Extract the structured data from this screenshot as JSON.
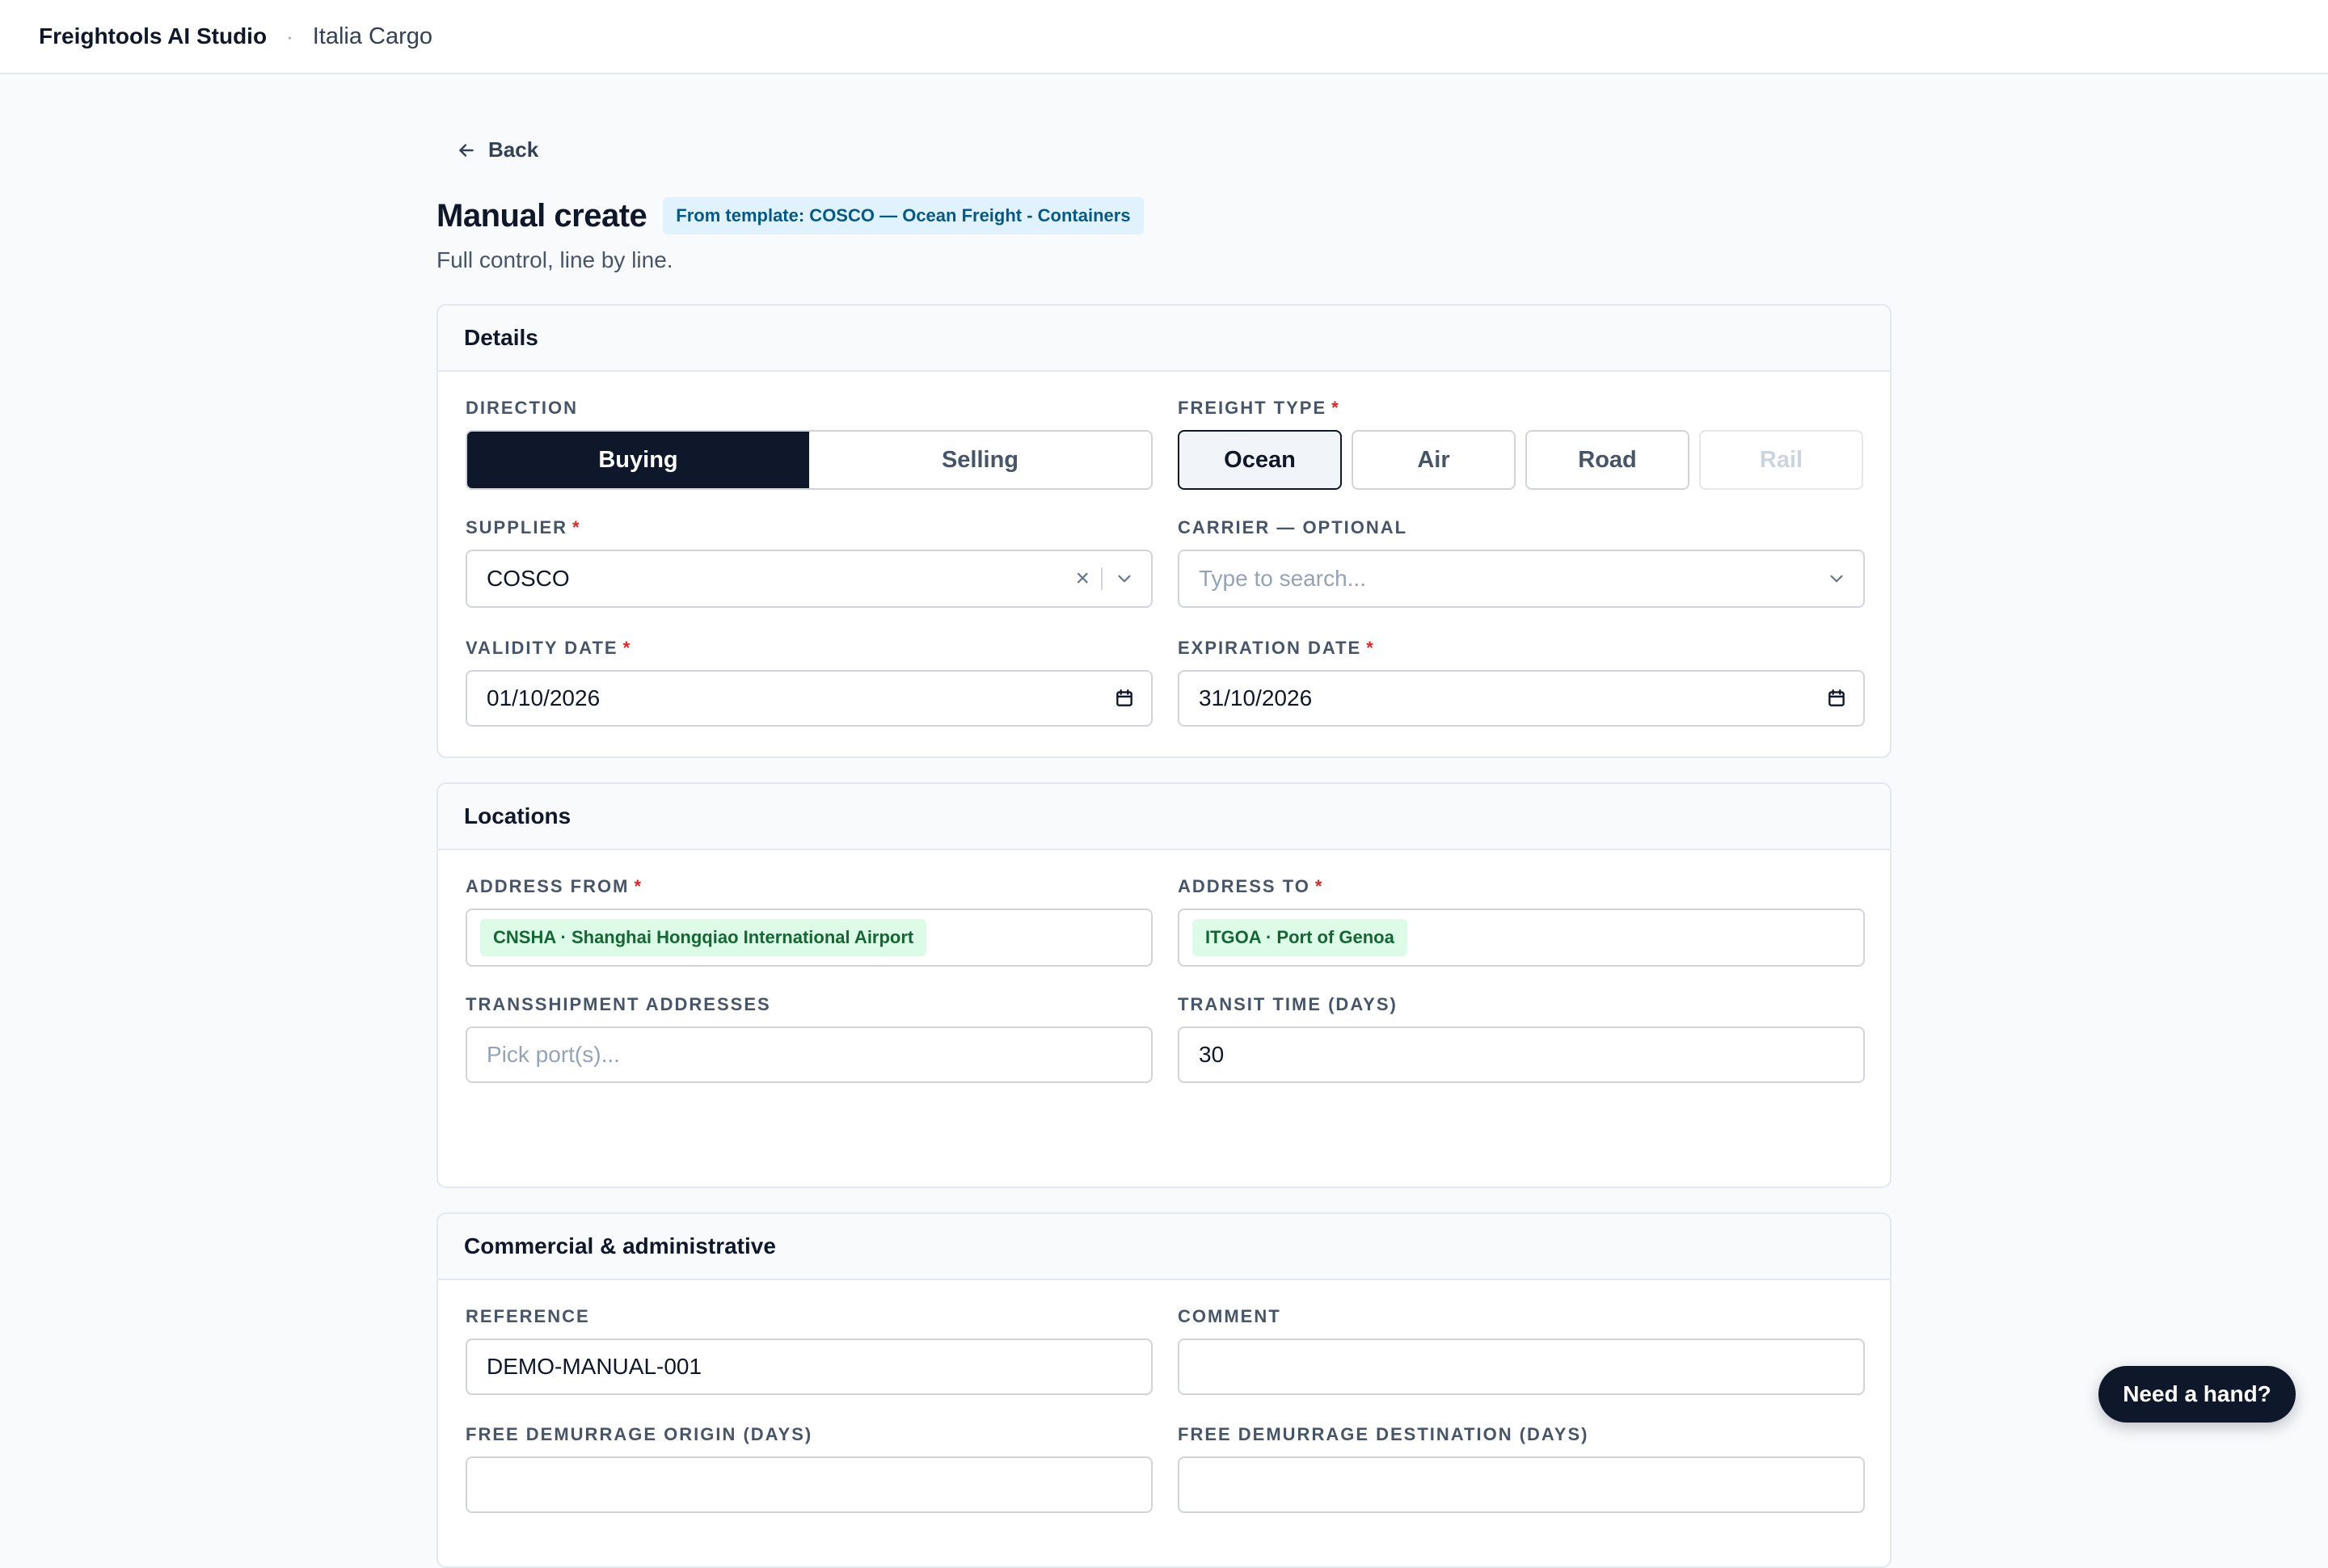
{
  "topbar": {
    "brand": "Freightools AI Studio",
    "separator": "·",
    "workspace": "Italia Cargo"
  },
  "back_label": "Back",
  "page": {
    "title": "Manual create",
    "template_badge": "From template: COSCO — Ocean Freight - Containers",
    "subtitle": "Full control, line by line."
  },
  "details": {
    "title": "Details",
    "direction": {
      "label": "DIRECTION",
      "options": [
        "Buying",
        "Selling"
      ],
      "selected": "Buying"
    },
    "freight_type": {
      "label": "FREIGHT TYPE",
      "options": [
        "Ocean",
        "Air",
        "Road",
        "Rail"
      ],
      "selected": "Ocean",
      "disabled": [
        "Rail"
      ]
    },
    "supplier": {
      "label": "SUPPLIER",
      "value": "COSCO",
      "clear": "×"
    },
    "carrier": {
      "label": "CARRIER — OPTIONAL",
      "placeholder": "Type to search..."
    },
    "validity_date": {
      "label": "VALIDITY DATE",
      "value": "01/10/2026"
    },
    "expiration_date": {
      "label": "EXPIRATION DATE",
      "value": "31/10/2026"
    }
  },
  "locations": {
    "title": "Locations",
    "address_from": {
      "label": "ADDRESS FROM",
      "chip": "CNSHA · Shanghai Hongqiao International Airport"
    },
    "address_to": {
      "label": "ADDRESS TO",
      "chip": "ITGOA · Port of Genoa"
    },
    "transshipment": {
      "label": "TRANSSHIPMENT ADDRESSES",
      "placeholder": "Pick port(s)..."
    },
    "transit_time": {
      "label": "TRANSIT TIME (DAYS)",
      "value": "30"
    }
  },
  "commercial": {
    "title": "Commercial & administrative",
    "reference": {
      "label": "REFERENCE",
      "value": "DEMO-MANUAL-001"
    },
    "comment": {
      "label": "COMMENT",
      "value": ""
    },
    "free_demurrage_origin": {
      "label": "FREE DEMURRAGE ORIGIN (DAYS)",
      "value": ""
    },
    "free_demurrage_destination": {
      "label": "FREE DEMURRAGE DESTINATION (DAYS)",
      "value": ""
    }
  },
  "help_button": "Need a hand?",
  "colors": {
    "primary": "#0f172a",
    "badge_bg": "#e0f2fe",
    "chip_bg": "#dcfce7",
    "required": "#dc2626"
  },
  "icons": {
    "back": "arrow-left-icon",
    "dropdown": "chevron-down-icon",
    "calendar": "calendar-icon",
    "clear": "close-icon"
  }
}
